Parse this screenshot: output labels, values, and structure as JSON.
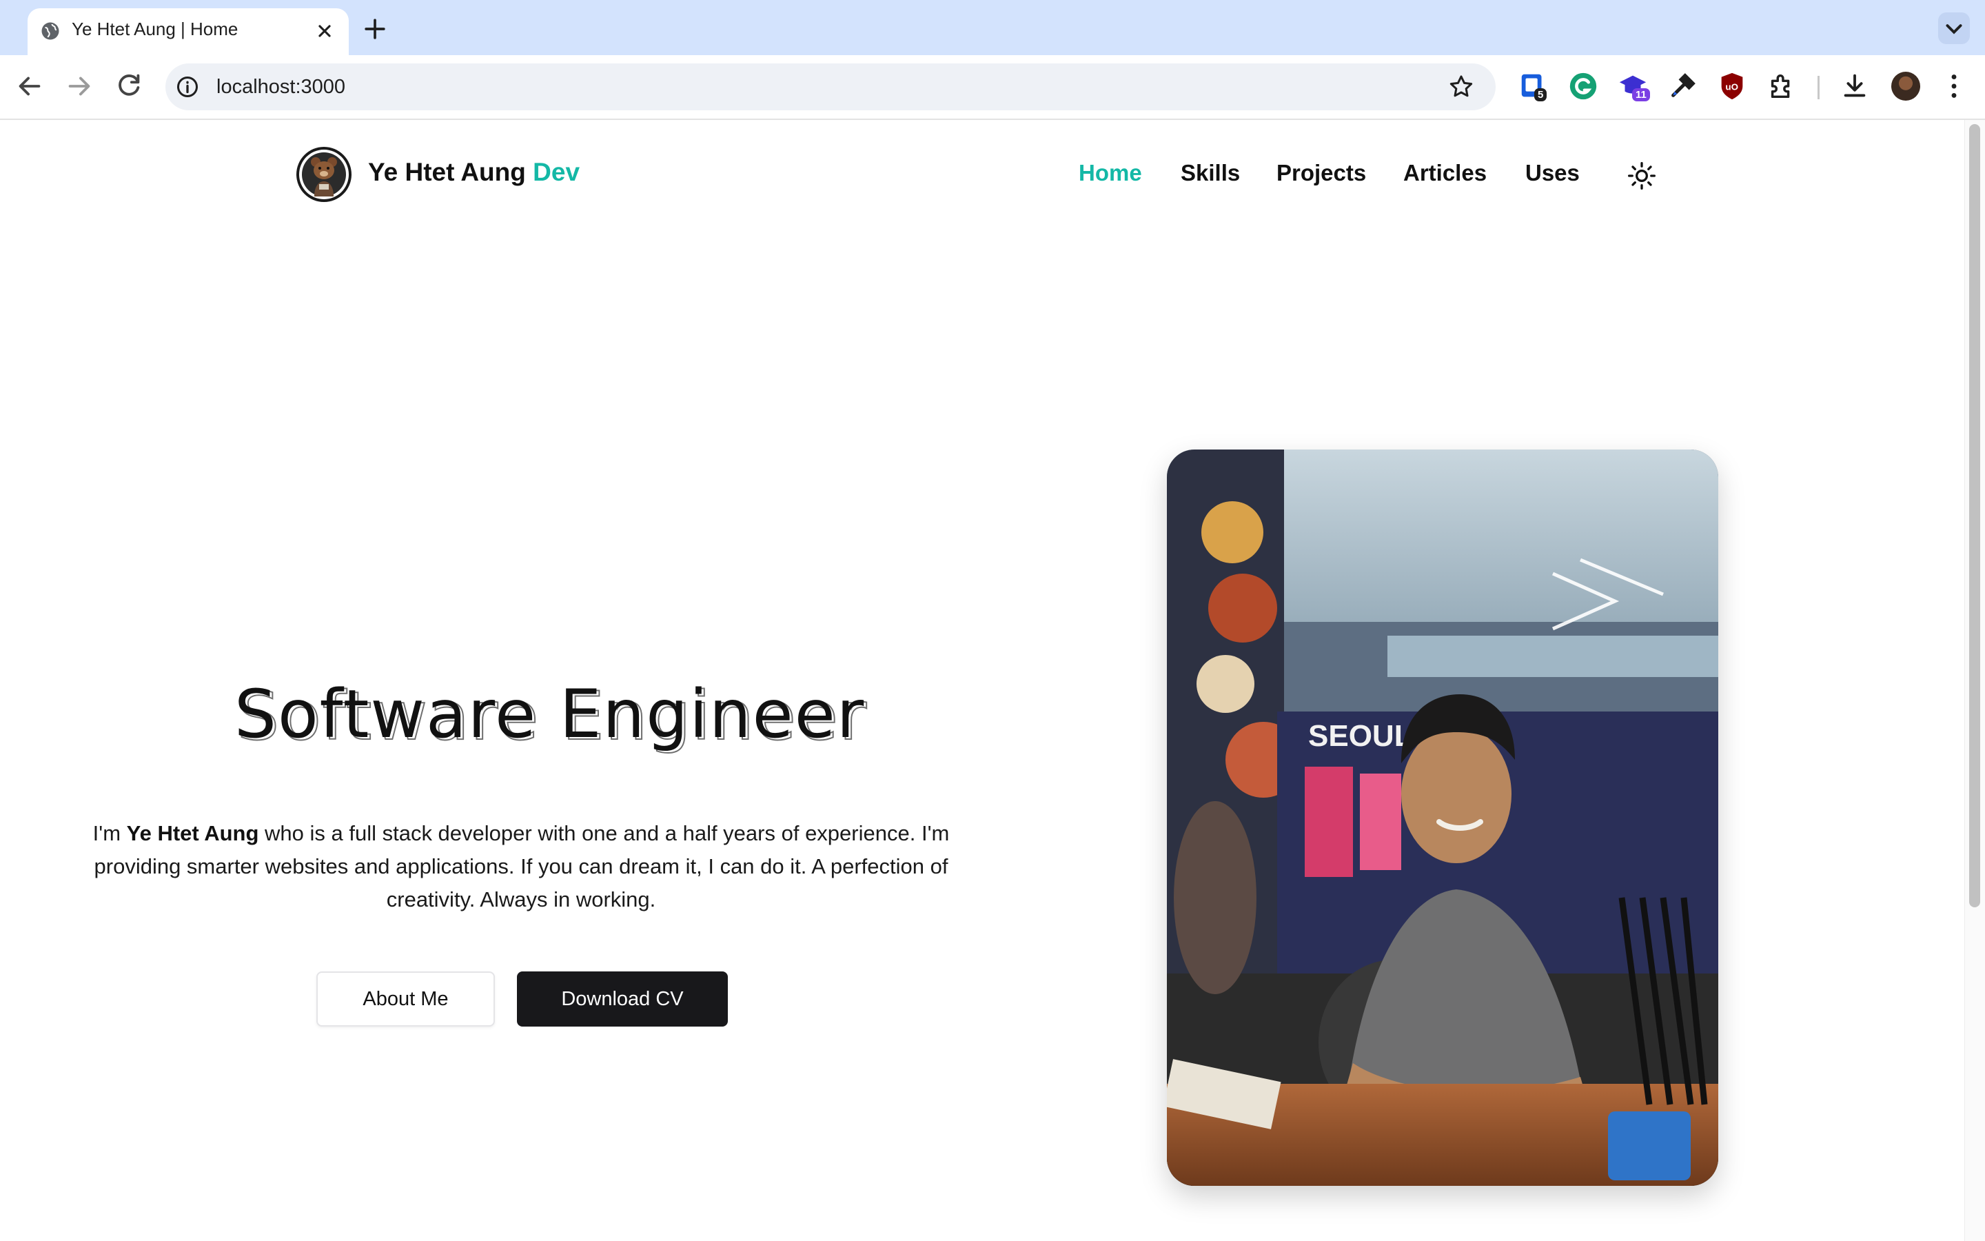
{
  "browser": {
    "tab_title": "Ye Htet Aung | Home",
    "url": "localhost:3000",
    "extensions": [
      {
        "name": "bitwarden-extension",
        "badge": "5"
      },
      {
        "name": "grammarly-extension",
        "badge": ""
      },
      {
        "name": "study-extension",
        "badge": "11"
      },
      {
        "name": "eyedropper-extension",
        "badge": ""
      },
      {
        "name": "ublock-extension",
        "badge": ""
      }
    ]
  },
  "site": {
    "brand_name": "Ye Htet Aung",
    "brand_suffix": "Dev",
    "accent_color": "#14b8a6",
    "nav": [
      {
        "label": "Home",
        "active": true
      },
      {
        "label": "Skills",
        "active": false
      },
      {
        "label": "Projects",
        "active": false
      },
      {
        "label": "Articles",
        "active": false
      },
      {
        "label": "Uses",
        "active": false
      }
    ],
    "theme_toggle_icon": "sun-icon"
  },
  "hero": {
    "title": "Software Engineer",
    "intro_prefix": "I'm ",
    "name": "Ye Htet Aung",
    "intro_rest": " who is a full stack developer with one and a half years of experience. I'm providing smarter websites and applications. If you can dream it, I can do it. A perfection of creativity. Always in working.",
    "about_button": "About Me",
    "cv_button": "Download CV"
  }
}
